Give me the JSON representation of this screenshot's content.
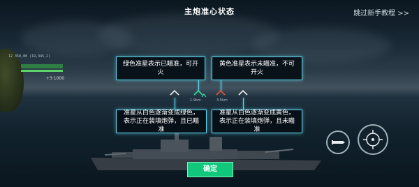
{
  "header": {
    "title": "主炮准心状态",
    "skip_label": "跳过新手教程 >>"
  },
  "left_hud": {
    "line1": "12 350,00 (19,345,2)",
    "score": "+3·1000"
  },
  "callouts": {
    "green_ready": "绿色准星表示已瞄准，可开火",
    "yellow_not_ready": "黄色准星表示未瞄准，不可开火",
    "green_loading": "准星从白色逐渐变成绿色，表示正在装填炮弹，且已瞄准",
    "yellow_loading": "准星从白色逐渐变成黄色，表示正在装填炮弹，且未瞄准"
  },
  "range_readout": {
    "left": "1.9km",
    "right": "3.5km"
  },
  "colors": {
    "callout_border": "#5dd6ec",
    "confirm": "#10c77c",
    "green_reticle": "#33e0a0",
    "red_reticle": "#e0563a",
    "white_reticle": "#e8eef2"
  },
  "confirm_label": "确定",
  "right_buttons": [
    "torpedo-icon",
    "crosshair-icon"
  ]
}
